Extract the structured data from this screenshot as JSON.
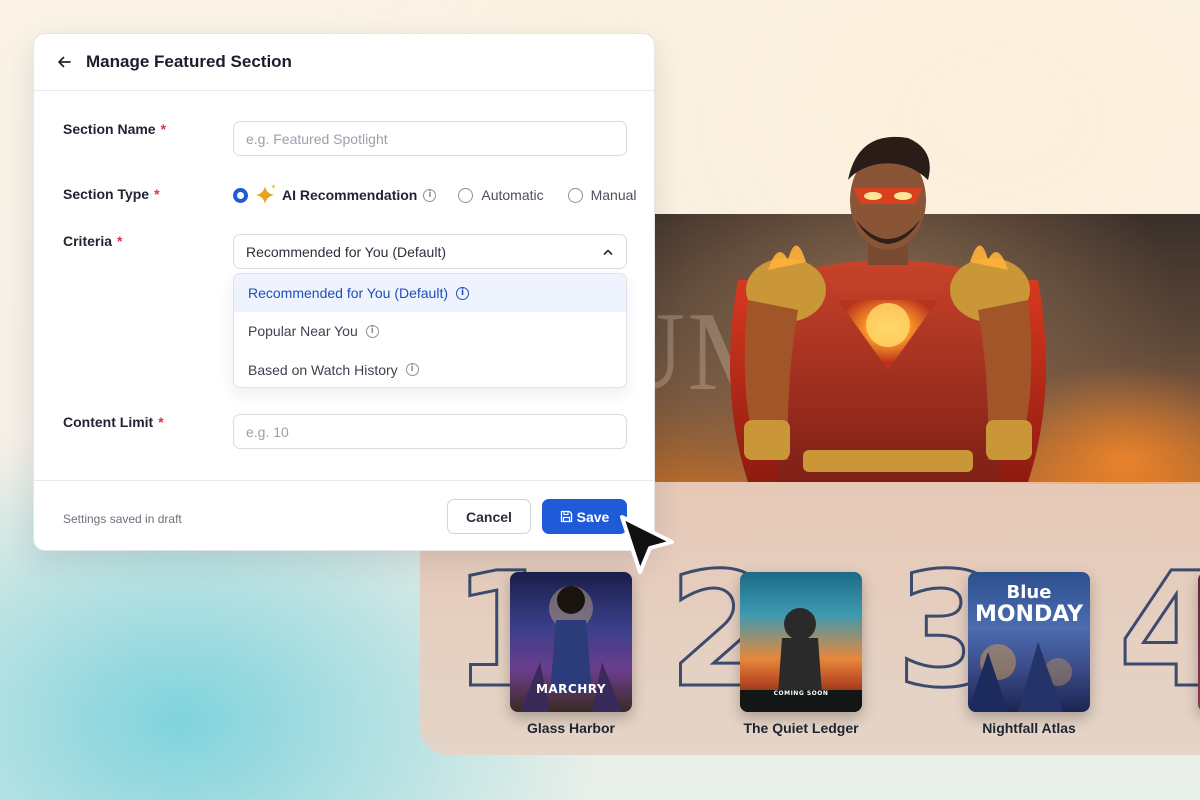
{
  "modal": {
    "title": "Manage Featured Section",
    "fields": {
      "section_name": {
        "label": "Section Name",
        "required_mark": "*",
        "placeholder": "e.g. Featured Spotlight",
        "value": ""
      },
      "section_type": {
        "label": "Section Type",
        "required_mark": "*",
        "options": [
          {
            "label": "AI Recommendation",
            "selected": true
          },
          {
            "label": "Automatic",
            "selected": false
          },
          {
            "label": "Manual",
            "selected": false
          }
        ]
      },
      "criteria": {
        "label": "Criteria",
        "required_mark": "*",
        "selected": "Recommended for You (Default)",
        "options": [
          {
            "label": "Recommended for You (Default)",
            "active": true
          },
          {
            "label": "Popular Near You",
            "active": false
          },
          {
            "label": "Based on Watch History",
            "active": false
          }
        ]
      },
      "content_limit": {
        "label": "Content Limit",
        "required_mark": "*",
        "placeholder": "e.g. 10",
        "value": ""
      }
    },
    "footer": {
      "note": "Settings saved in draft",
      "cancel_label": "Cancel",
      "save_label": "Save"
    }
  },
  "showcase": {
    "hero_title": "TITANIUM",
    "ranked": [
      {
        "rank": "1",
        "title": "Glass Harbor",
        "poster_text": "MARCHRY"
      },
      {
        "rank": "2",
        "title": "The Quiet Ledger",
        "poster_text": "COMING SOON"
      },
      {
        "rank": "3",
        "title": "Nightfall Atlas",
        "poster_text_top": "Blue",
        "poster_text_bottom": "MONDAY"
      },
      {
        "rank": "4",
        "title": ""
      }
    ]
  },
  "colors": {
    "primary": "#1f5ad8",
    "required": "#e0323c",
    "active_option_bg": "#eef3fd"
  }
}
